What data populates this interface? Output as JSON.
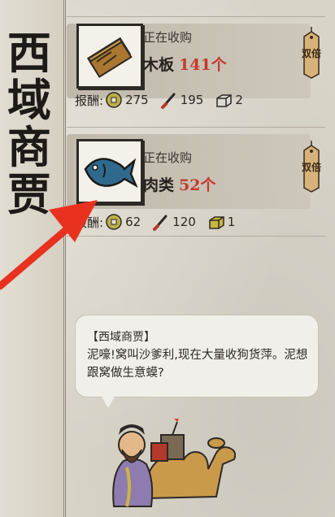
{
  "title": "西域商贾",
  "orders": [
    {
      "status": "正在收购",
      "item_name": "木板",
      "quantity": "141个",
      "icon": "wood-plank-icon",
      "badge": "双倍",
      "reward_label": "报酬:",
      "rewards": [
        {
          "icon": "copper-coin-icon",
          "value": "275"
        },
        {
          "icon": "brush-icon",
          "value": "195"
        },
        {
          "icon": "stone-block-icon",
          "value": "2"
        }
      ]
    },
    {
      "status": "正在收购",
      "item_name": "肉类",
      "quantity": "52个",
      "icon": "fish-icon",
      "badge": "双倍",
      "reward_label": "报酬:",
      "rewards": [
        {
          "icon": "copper-coin-icon",
          "value": "62"
        },
        {
          "icon": "brush-icon",
          "value": "120"
        },
        {
          "icon": "gold-bar-icon",
          "value": "1"
        }
      ]
    }
  ],
  "dialog": {
    "speaker": "【西域商贾】",
    "text": "泥嚎!窝叫沙爹利,现在大量收狗货萍。泥想跟窝做生意蟆?"
  },
  "colors": {
    "quantity": "#c43a2c",
    "arrow": "#e8321f",
    "paper": "#d9d4c8"
  }
}
